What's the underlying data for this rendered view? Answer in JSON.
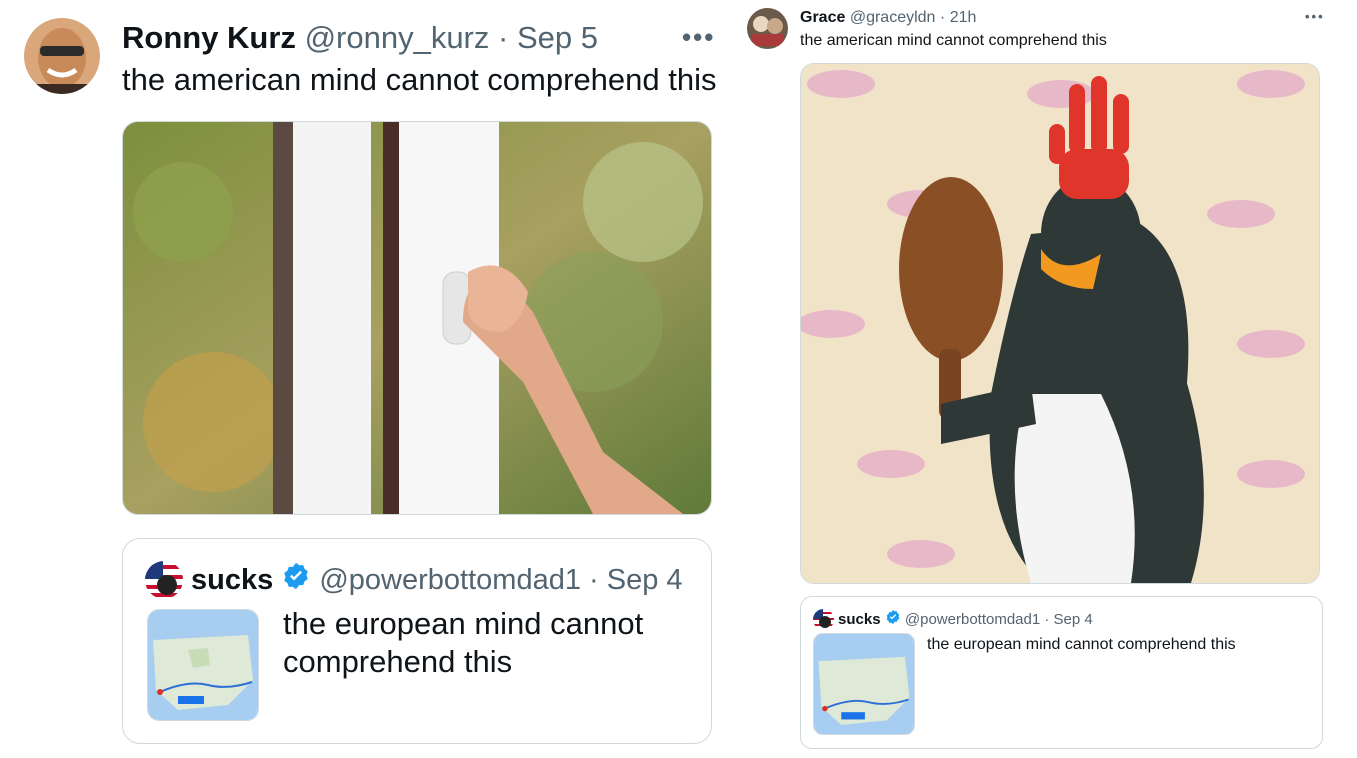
{
  "left_tweet": {
    "author_name": "Ronny Kurz",
    "handle": "@ronny_kurz",
    "separator": "·",
    "date": "Sep 5",
    "text": "the american mind cannot comprehend this",
    "more_icon": "more-horizontal-icon",
    "image_subject": "hand opening a white tilt-and-turn window",
    "quote": {
      "author_name": "sucks",
      "handle": "@powerbottomdad1",
      "separator": "·",
      "date": "Sep 4",
      "text_line1": "the european mind cannot",
      "text_line2": "comprehend this",
      "verified_icon": "verified-badge-icon",
      "thumbnail_subject": "map route across the united states"
    }
  },
  "right_tweet": {
    "author_name": "Grace",
    "handle": "@graceyldn",
    "separator": "·",
    "time": "21h",
    "text": "the american mind cannot comprehend this",
    "more_icon": "more-horizontal-icon",
    "image_subject": "clay penguin with red glove on head holding wooden spoon",
    "quote": {
      "author_name": "sucks",
      "handle": "@powerbottomdad1",
      "separator": "·",
      "date": "Sep 4",
      "text": "the european mind cannot comprehend this",
      "verified_icon": "verified-badge-icon",
      "thumbnail_subject": "map route across the united states"
    }
  },
  "colors": {
    "verified_blue": "#1d9bf0",
    "text_primary": "#0f1419",
    "text_secondary": "#536471",
    "border": "#cfd9de"
  }
}
